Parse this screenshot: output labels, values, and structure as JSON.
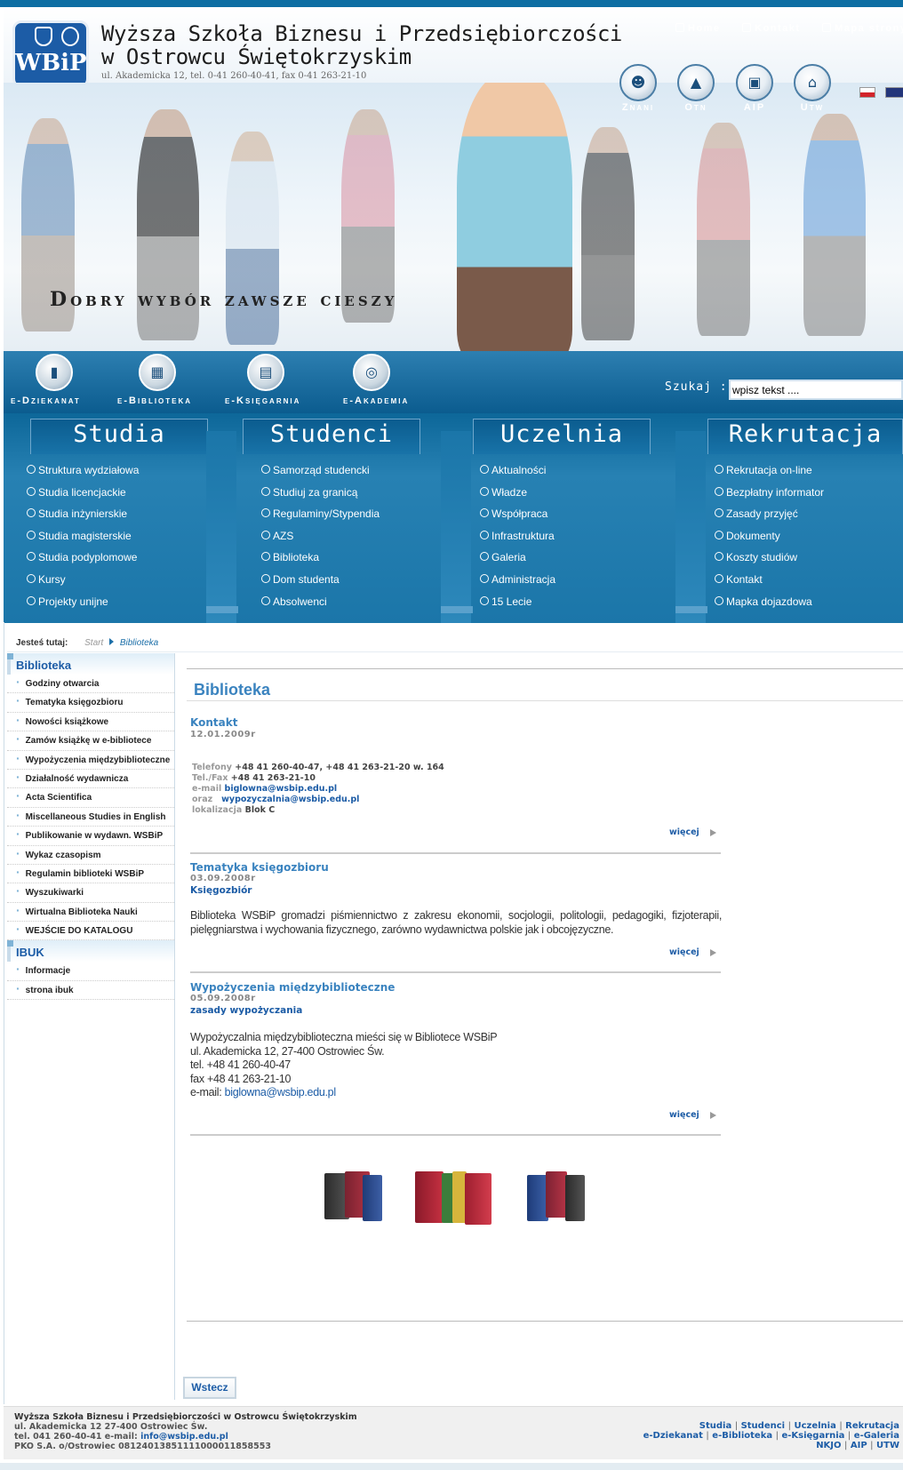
{
  "header": {
    "logo_text": "WBiP",
    "school_line1": "Wyższa Szkoła Biznesu i Przedsiębiorczości",
    "school_line2": "w Ostrowcu Świętokrzyskim",
    "address": "ul. Akademicka 12, tel. 0-41 260-40-41, fax 0-41 263-21-10",
    "links": {
      "home": "Home",
      "contact": "Kontakt",
      "sitemap": "Mapa strony"
    },
    "circles": [
      {
        "label": "Znani",
        "icon": "group-icon"
      },
      {
        "label": "Otn",
        "icon": "graduation-cap-icon"
      },
      {
        "label": "AIP",
        "icon": "briefcase-icon"
      },
      {
        "label": "Utw",
        "icon": "building-icon"
      }
    ],
    "slogan": "Dobry wybór zawsze cieszy"
  },
  "ebar": {
    "items": [
      {
        "label": "e-Dziekanat",
        "icon": "book-icon"
      },
      {
        "label": "e-Biblioteka",
        "icon": "calculator-icon"
      },
      {
        "label": "e-Księgarnia",
        "icon": "bookstore-icon"
      },
      {
        "label": "e-Akademia",
        "icon": "globe-icon"
      }
    ],
    "search_label": "Szukaj :",
    "search_value": "wpisz tekst ...."
  },
  "menu": {
    "studia": {
      "title": "Studia",
      "items": [
        "Struktura wydziałowa",
        "Studia licencjackie",
        "Studia inżynierskie",
        "Studia magisterskie",
        "Studia podyplomowe",
        "Kursy",
        "Projekty unijne"
      ]
    },
    "studenci": {
      "title": "Studenci",
      "items": [
        "Samorząd studencki",
        "Studiuj za granicą",
        "Regulaminy/Stypendia",
        "AZS",
        "Biblioteka",
        "Dom studenta",
        "Absolwenci"
      ]
    },
    "uczelnia": {
      "title": "Uczelnia",
      "items": [
        "Aktualności",
        "Władze",
        "Współpraca",
        "Infrastruktura",
        "Galeria",
        "Administracja",
        "15 Lecie"
      ]
    },
    "rekrutacja": {
      "title": "Rekrutacja",
      "items": [
        "Rekrutacja on-line",
        "Bezpłatny informator",
        "Zasady przyjęć",
        "Dokumenty",
        "Koszty studiów",
        "Kontakt",
        "Mapka dojazdowa"
      ]
    }
  },
  "breadcrumb": {
    "label": "Jesteś tutaj:",
    "start": "Start",
    "current": "Biblioteka"
  },
  "sidebar": {
    "section1": "Biblioteka",
    "items1": [
      "Godziny otwarcia",
      "Tematyka księgozbioru",
      "Nowości książkowe",
      "Zamów książkę w e-bibliotece",
      "Wypożyczenia międzybiblioteczne",
      "Działalność wydawnicza",
      "Acta Scientifica",
      "Miscellaneous Studies in English",
      "Publikowanie w wydawn. WSBiP",
      "Wykaz czasopism",
      "Regulamin biblioteki WSBiP",
      "Wyszukiwarki",
      "Wirtualna Biblioteka Nauki",
      "WEJŚCIE DO KATALOGU"
    ],
    "section2": "IBUK",
    "items2": [
      "Informacje",
      "strona ibuk"
    ]
  },
  "content": {
    "title": "Biblioteka",
    "more": "więcej",
    "a1": {
      "title": "Kontakt",
      "date": "12.01.2009r",
      "tel_label": "Telefony",
      "tel": "+48 41 260-40-47,  +48 41 263-21-20 w. 164",
      "fax_label": "Tel./Fax",
      "fax": "+48 41 263-21-10",
      "email_label": "e-mail",
      "email": "biglowna@wsbip.edu.pl",
      "oraz": "oraz",
      "email2": "wypozyczalnia@wsbip.edu.pl",
      "loc_label": "lokalizacja",
      "loc": "Blok C"
    },
    "a2": {
      "title": "Tematyka księgozbioru",
      "date": "03.09.2008r",
      "sub": "Księgozbiór",
      "text": "Biblioteka WSBiP gromadzi piśmiennictwo z zakresu ekonomii, socjologii, politologii, pedagogiki, fizjoterapii, pielęgniarstwa i wychowania fizycznego, zarówno wydawnictwa polskie jak i obcojęzyczne."
    },
    "a3": {
      "title": "Wypożyczenia międzybiblioteczne",
      "date": "05.09.2008r",
      "sub": "zasady wypożyczania",
      "l1": "Wypożyczalnia międzybiblioteczna mieści się w Bibliotece WSBiP",
      "l2": "ul. Akademicka 12, 27-400 Ostrowiec Św.",
      "l3": "tel. +48 41 260-40-47",
      "l4": "fax +48 41 263-21-10",
      "l5_label": "e-mail: ",
      "l5": "biglowna@wsbip.edu.pl"
    },
    "back": "Wstecz"
  },
  "footer": {
    "name": "Wyższa Szkoła Biznesu i Przedsiębiorczości w Ostrowcu Świętokrzyskim",
    "addr": "ul. Akademicka 12 27-400 Ostrowiec Św.",
    "tel": "tel. 041 260-40-41 e-mail: ",
    "email": "info@wsbip.edu.pl",
    "bank": "PKO S.A. o/Ostrowiec 08124013851111000011858553",
    "links1": [
      "Studia",
      "Studenci",
      "Uczelnia",
      "Rekrutacja"
    ],
    "links2": [
      "e-Dziekanat",
      "e-Biblioteka",
      "e-Księgarnia",
      "e-Galeria"
    ],
    "links3": [
      "NKJO",
      "AIP",
      "UTW"
    ]
  },
  "colors": {
    "brand": "#0e6ea3",
    "link": "#3a83bf"
  }
}
